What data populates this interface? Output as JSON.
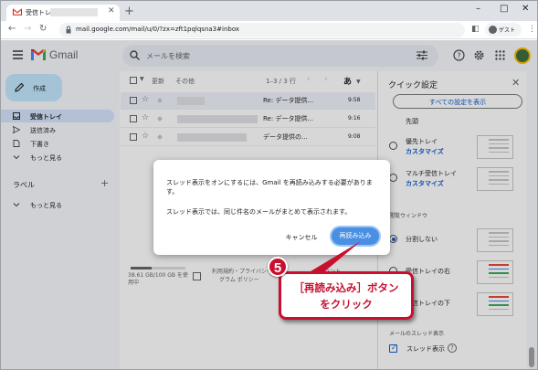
{
  "browser": {
    "tab_title": "受信トレイ",
    "new_tab": "+",
    "url": "mail.google.com/mail/u/0/?zx=zft1pqlqsna3#inbox",
    "guest_label": "ゲスト",
    "window_min": "–",
    "window_max": "□",
    "window_close": "✕"
  },
  "gmail": {
    "logo_text": "Gmail",
    "search_placeholder": "メールを検索",
    "compose_label": "作成",
    "nav": [
      {
        "label": "受信トレイ",
        "icon": "inbox-icon",
        "active": true
      },
      {
        "label": "送信済み",
        "icon": "send-icon",
        "active": false
      },
      {
        "label": "下書き",
        "icon": "draft-icon",
        "active": false
      },
      {
        "label": "もっと見る",
        "icon": "chevron-down-icon",
        "active": false
      }
    ],
    "labels_heading": "ラベル",
    "labels_more": "もっと見る",
    "list": {
      "refresh": "更新",
      "more": "その他",
      "range": "1–3 / 3 行",
      "input_tool": "あ",
      "rows": [
        {
          "subject": "Re: データ提供...",
          "time": "9:58",
          "selected": true
        },
        {
          "subject": "Re: データ提供...",
          "time": "9:16",
          "selected": false
        },
        {
          "subject": "データ提供の...",
          "time": "9:08",
          "selected": false
        }
      ]
    },
    "footer": {
      "storage": "38.61 GB/100 GB を使用中",
      "storage_fraction": 0.39,
      "terms_line1": "利用規約・プライバシー・",
      "terms_line2": "グラム ポリシー",
      "activity": "アカウント"
    },
    "quick_settings": {
      "title": "クイック設定",
      "all_settings": "すべての設定を表示",
      "inbox_type_partial": "先頭",
      "options": [
        {
          "name": "優先トレイ",
          "customize": "カスタマイズ"
        },
        {
          "name": "マルチ受信トレイ",
          "customize": "カスタマイズ"
        }
      ],
      "reading_pane_heading": "閲覧ウィンドウ",
      "reading_pane": [
        "分割しない",
        "受信トレイの右",
        "受信トレイの下"
      ],
      "thread_heading": "メールのスレッド表示",
      "thread_label": "スレッド表示",
      "help": "?"
    }
  },
  "dialog": {
    "message1": "スレッド表示をオンにするには、Gmail を再読み込みする必要があります。",
    "message2": "スレッド表示では、同じ件名のメールがまとめて表示されます。",
    "cancel_label": "キャンセル",
    "reload_label": "再読み込み"
  },
  "callout": {
    "step_number": "5",
    "line1": "［再読み込み］ボタン",
    "line2": "をクリック",
    "color": "#c8102e"
  }
}
